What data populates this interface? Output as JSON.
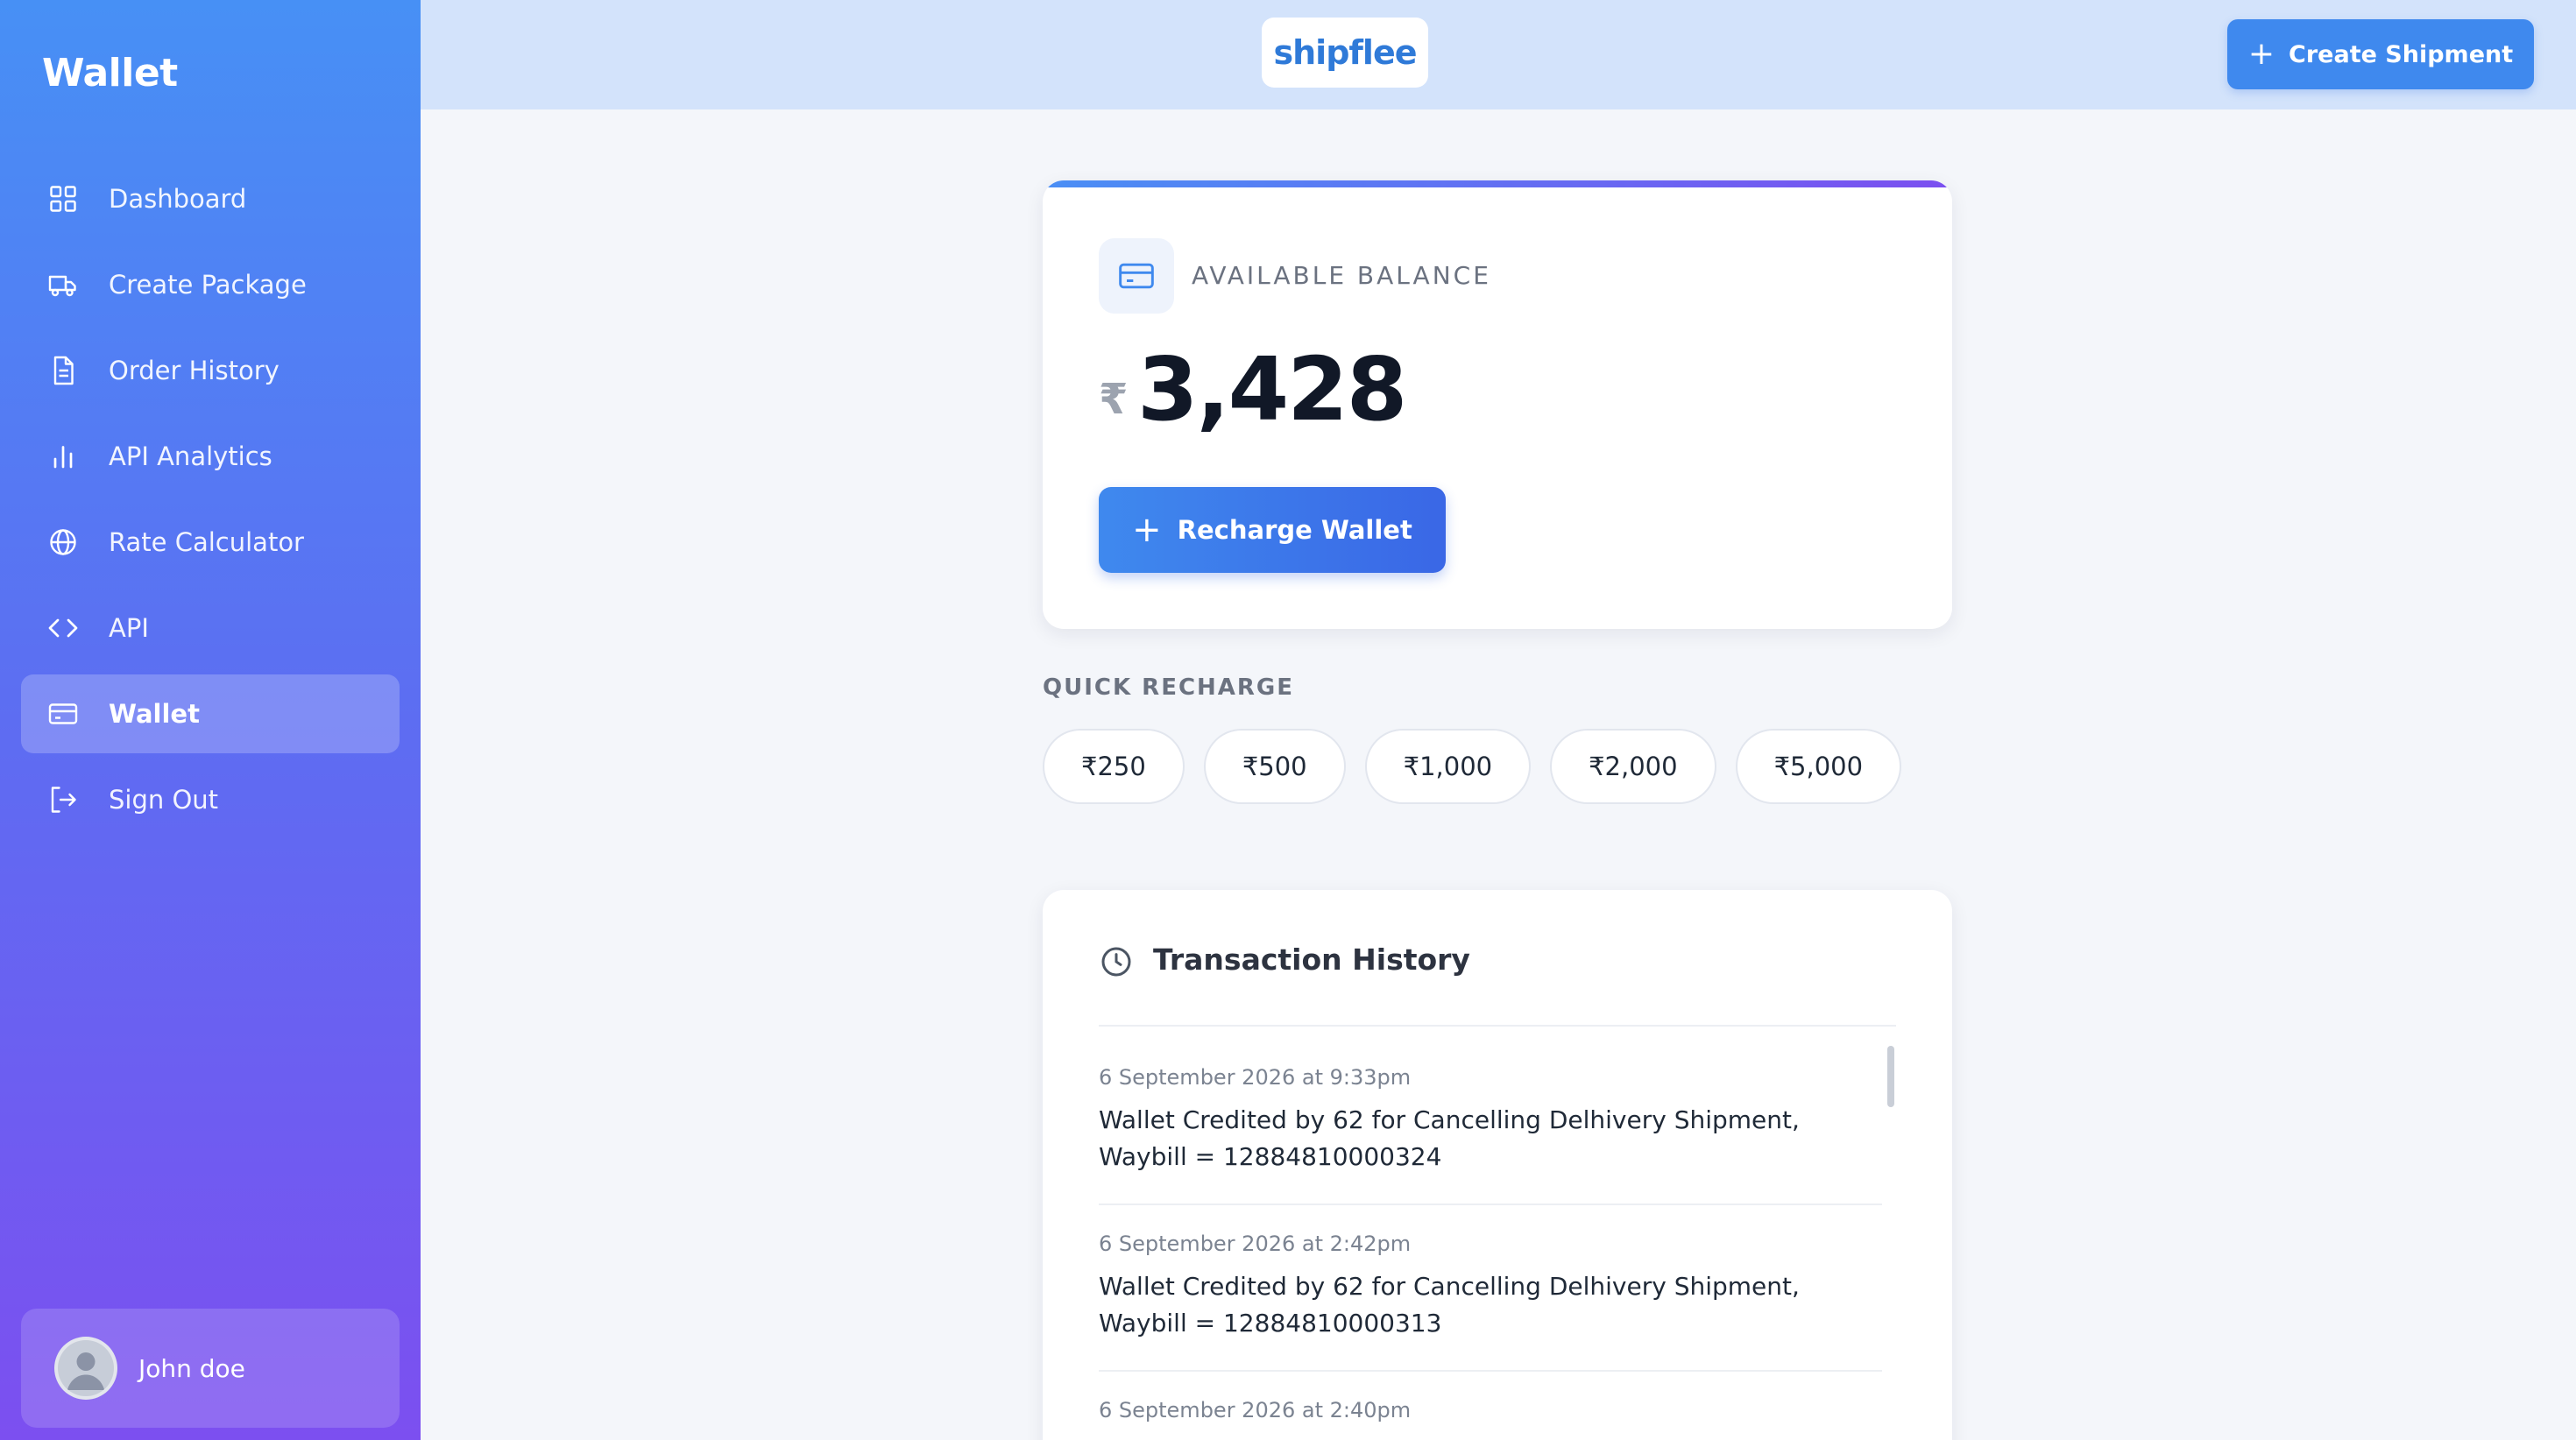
{
  "sidebar": {
    "title": "Wallet",
    "items": [
      {
        "label": "Dashboard",
        "icon": "grid-icon"
      },
      {
        "label": "Create Package",
        "icon": "truck-icon"
      },
      {
        "label": "Order History",
        "icon": "document-icon"
      },
      {
        "label": "API Analytics",
        "icon": "bar-chart-icon"
      },
      {
        "label": "Rate Calculator",
        "icon": "globe-icon"
      },
      {
        "label": "API",
        "icon": "code-icon"
      },
      {
        "label": "Wallet",
        "icon": "credit-card-icon",
        "active": true
      },
      {
        "label": "Sign Out",
        "icon": "sign-out-icon"
      }
    ],
    "user": {
      "name": "John doe"
    }
  },
  "header": {
    "logo": "shipflee",
    "create_shipment_label": "Create Shipment"
  },
  "balance": {
    "label": "AVAILABLE BALANCE",
    "currency": "₹",
    "amount": "3,428",
    "recharge_label": "Recharge Wallet"
  },
  "quick_recharge": {
    "label": "QUICK RECHARGE",
    "amounts": [
      "₹250",
      "₹500",
      "₹1,000",
      "₹2,000",
      "₹5,000"
    ]
  },
  "transactions": {
    "title": "Transaction History",
    "items": [
      {
        "date": "6 September 2026 at 9:33pm",
        "description": "Wallet Credited by 62 for Cancelling Delhivery Shipment, Waybill = 12884810000324"
      },
      {
        "date": "6 September 2026 at 2:42pm",
        "description": "Wallet Credited by 62 for Cancelling Delhivery Shipment, Waybill = 12884810000313"
      },
      {
        "date": "6 September 2026 at 2:40pm",
        "description": ""
      }
    ]
  },
  "colors": {
    "accent": "#3f89ee",
    "sidebar_top": "#4790f5",
    "sidebar_bottom": "#7c4ff0",
    "topbar": "#d3e3fb"
  }
}
